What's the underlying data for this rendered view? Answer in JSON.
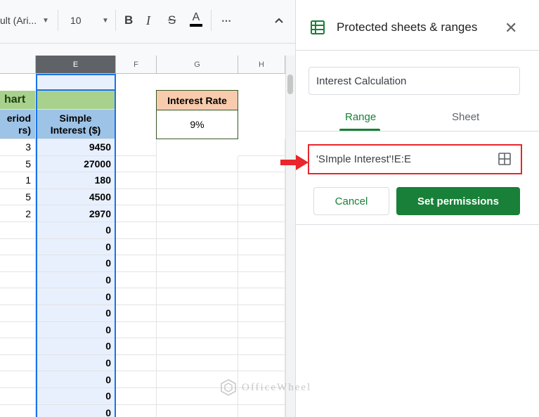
{
  "toolbar": {
    "font_name": "ult (Ari...",
    "font_size": "10",
    "bold_label": "B",
    "italic_label": "I",
    "strike_label": "S",
    "text_color_label": "A",
    "more_label": "⋯",
    "collapse_glyph": "^"
  },
  "columns": [
    {
      "label": "E",
      "selected": true
    },
    {
      "label": "F",
      "selected": false
    },
    {
      "label": "G",
      "selected": false
    },
    {
      "label": "H",
      "selected": false
    }
  ],
  "sheet": {
    "title_fragment": "hart",
    "period_header": "eriod\nrs)",
    "simple_interest_header": "Simple\nInterest ($)",
    "interest_rate_label": "Interest Rate",
    "interest_rate_value": "9%",
    "rows": [
      {
        "period": "3",
        "interest": "9450"
      },
      {
        "period": "5",
        "interest": "27000"
      },
      {
        "period": "1",
        "interest": "180"
      },
      {
        "period": "5",
        "interest": "4500"
      },
      {
        "period": "2",
        "interest": "2970"
      },
      {
        "period": "",
        "interest": "0"
      },
      {
        "period": "",
        "interest": "0"
      },
      {
        "period": "",
        "interest": "0"
      },
      {
        "period": "",
        "interest": "0"
      },
      {
        "period": "",
        "interest": "0"
      },
      {
        "period": "",
        "interest": "0"
      },
      {
        "period": "",
        "interest": "0"
      },
      {
        "period": "",
        "interest": "0"
      },
      {
        "period": "",
        "interest": "0"
      },
      {
        "period": "",
        "interest": "0"
      },
      {
        "period": "",
        "interest": "0"
      },
      {
        "period": "",
        "interest": "0"
      }
    ]
  },
  "panel": {
    "title": "Protected sheets & ranges",
    "close_glyph": "✕",
    "description_value": "Interest Calculation",
    "tabs": [
      {
        "label": "Range",
        "active": true
      },
      {
        "label": "Sheet",
        "active": false
      }
    ],
    "range_value": "'SImple Interest'!E:E",
    "cancel_label": "Cancel",
    "set_permissions_label": "Set permissions"
  },
  "watermark": {
    "text": "OfficeWheel"
  },
  "colors": {
    "accent_green": "#188038",
    "highlight_red": "#e8262b",
    "green_header": "#a9d18e",
    "blue_header": "#9dc3e6",
    "rate_header": "#f8cbad",
    "selection_blue": "#1a73e8"
  }
}
